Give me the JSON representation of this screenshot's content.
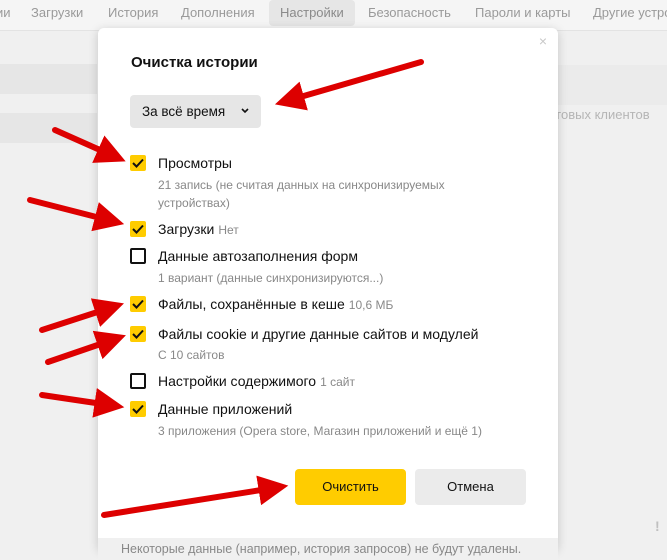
{
  "top_nav": {
    "tabs": [
      "ии",
      "Загрузки",
      "История",
      "Дополнения",
      "Настройки",
      "Безопасность",
      "Пароли и карты",
      "Другие устрой"
    ],
    "active": "Настройки"
  },
  "background": {
    "right_text": "нтовых клиентов",
    "warning_mark": "!"
  },
  "dialog": {
    "title": "Очистка истории",
    "close_glyph": "×",
    "period": "За всё время",
    "items": [
      {
        "label": "Просмотры",
        "extra": "",
        "sub": "21 запись (не считая данных на синхронизируемых устройствах)",
        "checked": true
      },
      {
        "label": "Загрузки",
        "extra": "Нет",
        "sub": "",
        "checked": true
      },
      {
        "label": "Данные автозаполнения форм",
        "extra": "",
        "sub": "1 вариант (данные синхронизируются...)",
        "checked": false
      },
      {
        "label": "Файлы, сохранённые в кеше",
        "extra": "10,6 МБ",
        "sub": "",
        "checked": true
      },
      {
        "label": "Файлы cookie и другие данные сайтов и модулей",
        "extra": "",
        "sub": "С 10 сайтов",
        "checked": true
      },
      {
        "label": "Настройки содержимого",
        "extra": "1 сайт",
        "sub": "",
        "checked": false
      },
      {
        "label": "Данные приложений",
        "extra": "",
        "sub": "3 приложения (Opera store, Магазин приложений и ещё 1)",
        "checked": true
      }
    ],
    "clear_button": "Очистить",
    "cancel_button": "Отмена",
    "footer": "Некоторые данные (например, история запросов) не будут удалены."
  },
  "colors": {
    "accent": "#ffcc00",
    "arrow": "#dd0000",
    "dialog_bg": "#ffffff",
    "page_bg": "#f0f0f0"
  }
}
